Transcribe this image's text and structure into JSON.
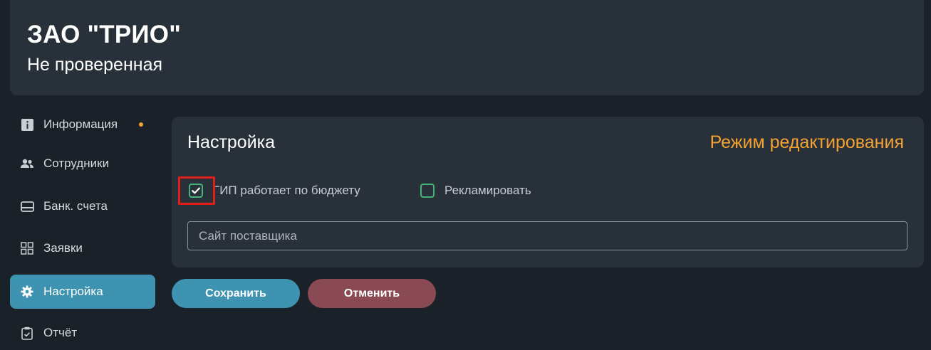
{
  "header": {
    "company_name": "ЗАО \"ТРИО\"",
    "status": "Не проверенная"
  },
  "sidebar": {
    "items": [
      {
        "label": "Информация",
        "icon": "info-icon",
        "has_dot": true
      },
      {
        "label": "Сотрудники",
        "icon": "users-icon"
      },
      {
        "label": "Банк. счета",
        "icon": "card-icon"
      },
      {
        "label": "Заявки",
        "icon": "grid-icon"
      },
      {
        "label": "Настройка",
        "icon": "gear-icon",
        "active": true
      },
      {
        "label": "Отчёт",
        "icon": "clipboard-icon"
      }
    ]
  },
  "settings": {
    "title": "Настройка",
    "edit_mode": "Режим редактирования",
    "budget_checkbox": {
      "label": "ГИП работает по бюджету",
      "checked": true
    },
    "advertise_checkbox": {
      "label": "Рекламировать",
      "checked": false
    },
    "site_input": {
      "placeholder": "Сайт поставщика",
      "value": ""
    }
  },
  "actions": {
    "save_label": "Сохранить",
    "cancel_label": "Отменить"
  },
  "colors": {
    "background": "#1b2128",
    "card": "#283039",
    "accent": "#3d93b0",
    "warning": "#f2a232",
    "checkbox_border": "#47b27a",
    "cancel": "#8a4a53",
    "highlight": "#e21b1b"
  }
}
